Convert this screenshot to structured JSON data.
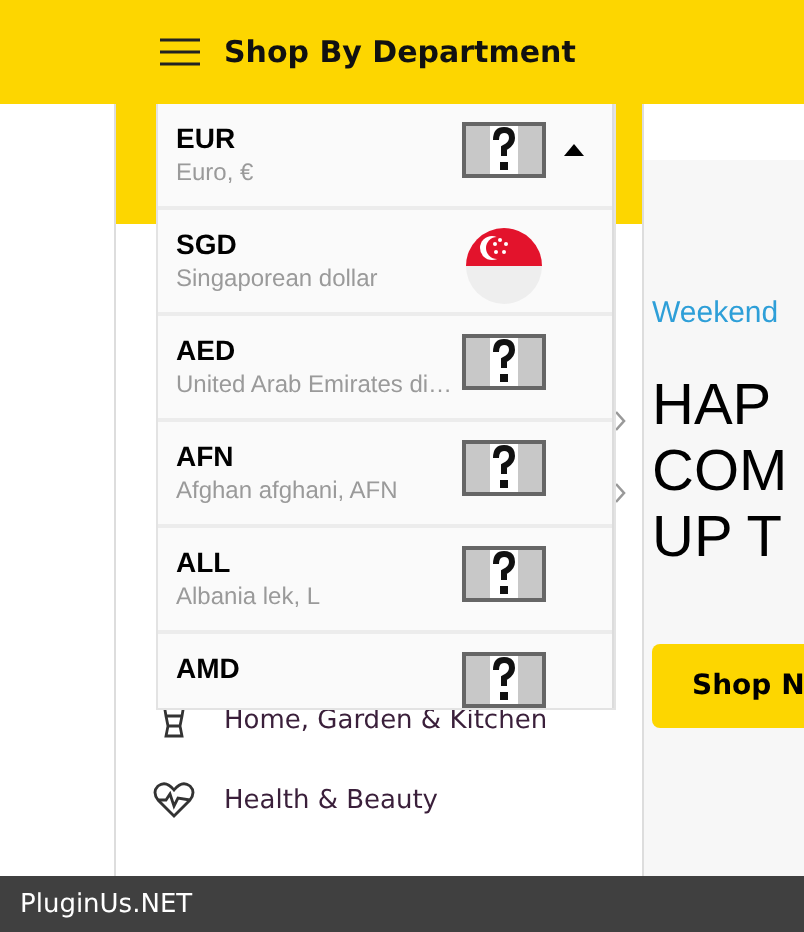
{
  "header": {
    "title": "Shop By Department"
  },
  "currency_dropdown": {
    "expanded": true,
    "items": [
      {
        "code": "EUR",
        "name": "Euro, €",
        "kind": "unknown"
      },
      {
        "code": "SGD",
        "name": "Singaporean dollar",
        "kind": "singapore"
      },
      {
        "code": "AED",
        "name": "United Arab Emirates di…",
        "kind": "unknown"
      },
      {
        "code": "AFN",
        "name": "Afghan afghani, AFN",
        "kind": "unknown"
      },
      {
        "code": "ALL",
        "name": "Albania lek, L",
        "kind": "unknown"
      },
      {
        "code": "AMD",
        "kind": "unknown"
      }
    ]
  },
  "departments": [
    {
      "label": "Home, Garden & Kitchen",
      "kind": "home-garden"
    },
    {
      "label": "Health & Beauty",
      "kind": "health"
    }
  ],
  "banner": {
    "tagline": "Weekend",
    "headline": [
      "HAP",
      "COM",
      "UP T"
    ],
    "button": "Shop N"
  },
  "footer": {
    "text": "PluginUs.NET"
  }
}
